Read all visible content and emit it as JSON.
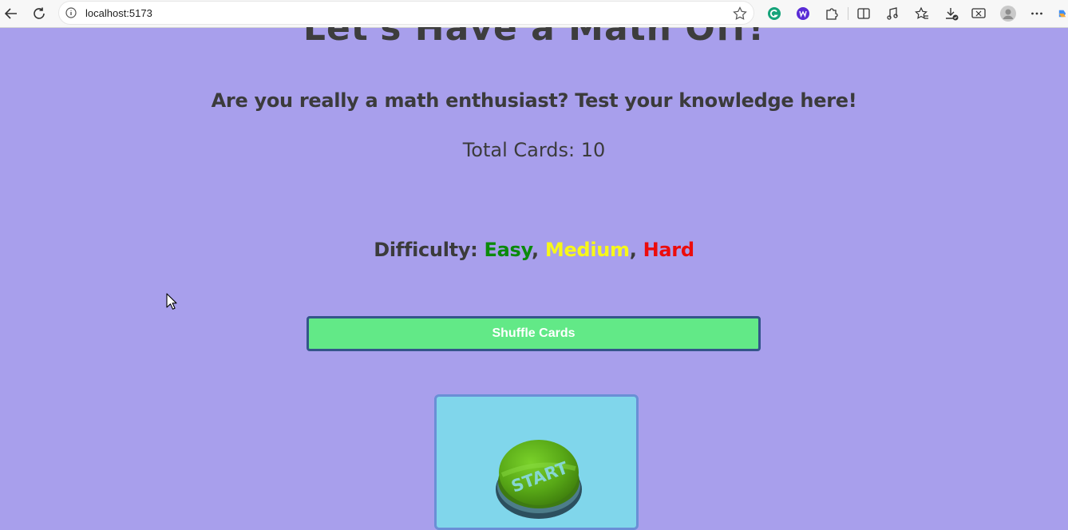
{
  "browser": {
    "url": "localhost:5173",
    "icons": [
      "back-icon",
      "refresh-icon",
      "site-info-icon",
      "favorite-star-icon",
      "grammarly-icon",
      "extension-w-icon",
      "extensions-puzzle-icon",
      "split-screen-icon",
      "read-aloud-icon",
      "favorites-icon",
      "downloads-icon",
      "screenshot-icon",
      "profile-avatar",
      "more-menu-icon",
      "copilot-icon"
    ]
  },
  "page": {
    "title": "Let's Have a Math Off!",
    "subtitle": "Are you really a math enthusiast? Test your knowledge here!",
    "total_cards": "Total Cards: 10",
    "difficulty": {
      "label": "Difficulty: ",
      "easy": "Easy",
      "sep1": ", ",
      "medium": "Medium",
      "sep2": ", ",
      "hard": "Hard"
    },
    "shuffle_label": "Shuffle Cards",
    "start_label": "START"
  },
  "colors": {
    "background": "#a89fec",
    "easy": "#0b8a0b",
    "medium": "#f7f71a",
    "hard": "#ec0c0c",
    "shuffle_button": "#62e987",
    "card": "#80d6eb"
  }
}
